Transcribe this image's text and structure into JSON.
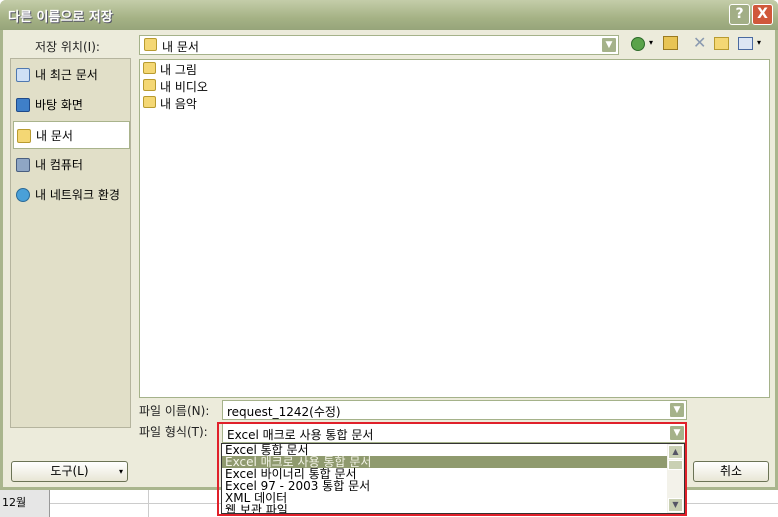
{
  "title": "다른 이름으로 저장",
  "help_label": "?",
  "close_label": "X",
  "location": {
    "label": "저장 위치(I):",
    "value": "내 문서"
  },
  "sidebar": [
    {
      "label": "내 최근 문서"
    },
    {
      "label": "바탕 화면"
    },
    {
      "label": "내 문서",
      "selected": true
    },
    {
      "label": "내 컴퓨터"
    },
    {
      "label": "내 네트워크 환경"
    }
  ],
  "files": [
    {
      "name": "내 그림"
    },
    {
      "name": "내 비디오"
    },
    {
      "name": "내 음악"
    }
  ],
  "filename": {
    "label": "파일 이름(N):",
    "value": "request_1242(수정)"
  },
  "filetype": {
    "label": "파일 형식(T):",
    "value": "Excel 매크로 사용 통합 문서",
    "options": [
      "Excel 통합 문서",
      "Excel 매크로 사용 통합 문서",
      "Excel 바이너리 통합 문서",
      "Excel 97 - 2003 통합 문서",
      "XML 데이터",
      "웹 보관 파일"
    ]
  },
  "tools_label": "도구(L)",
  "cancel_label": "취소",
  "sheet": {
    "cell": "12월"
  },
  "highlight_color": "#e0202a"
}
